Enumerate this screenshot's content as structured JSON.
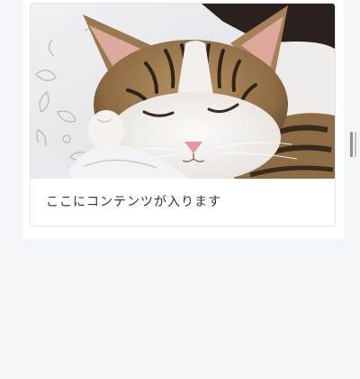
{
  "page": {
    "background_color": "#f2f6f9",
    "panel_color": "#ffffff"
  },
  "card": {
    "image_icon": "cat-photo",
    "text": "ここにコンテンツが入ります",
    "border_color": "#e3e5e8",
    "text_color": "#333333"
  },
  "handle": {
    "icon": "drag-handle-icon"
  }
}
